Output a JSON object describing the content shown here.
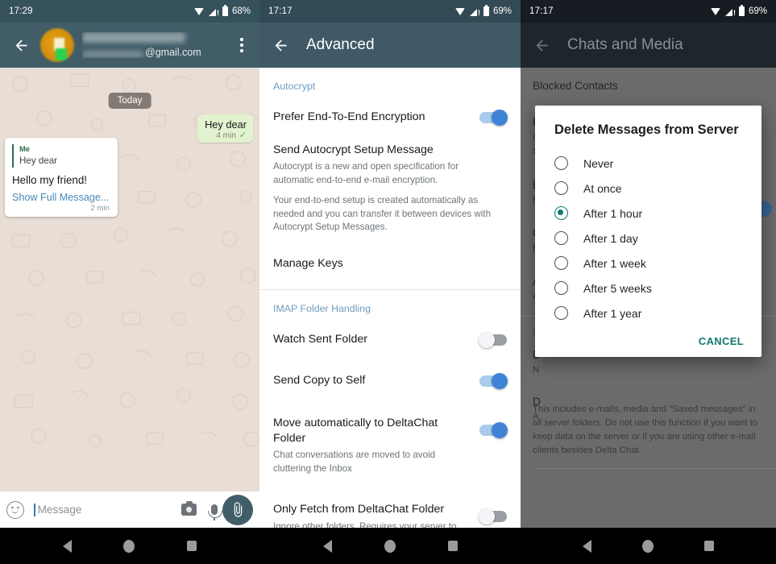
{
  "panel1": {
    "status": {
      "time": "17:29",
      "battery": "68%",
      "wifi_icon": "wifi-icon",
      "signal_icon": "signal-icon",
      "battery_icon": "battery-icon"
    },
    "appbar": {
      "back_icon": "back-arrow-icon",
      "avatar": "contact-avatar",
      "email_suffix": "@gmail.com",
      "overflow_icon": "overflow-menu-icon"
    },
    "chat": {
      "date_pill": "Today",
      "outgoing": {
        "text": "Hey dear",
        "time": "4 min",
        "status_icon": "sent-check-icon"
      },
      "notification": {
        "quote_author": "Me",
        "quote_text": "Hey dear",
        "body": "Hello my friend!",
        "link": "Show Full Message...",
        "time": "2 min"
      }
    },
    "compose": {
      "emoji_icon": "emoji-icon",
      "placeholder": "Message",
      "camera_icon": "camera-icon",
      "mic_icon": "microphone-icon",
      "attach_icon": "paperclip-icon"
    }
  },
  "panel2": {
    "status": {
      "time": "17:17",
      "battery": "69%"
    },
    "appbar": {
      "back_icon": "back-arrow-icon",
      "title": "Advanced"
    },
    "sections": [
      {
        "header": "Autocrypt",
        "rows": [
          {
            "title": "Prefer End-To-End Encryption",
            "subtitles": [],
            "toggle": "on"
          },
          {
            "title": "Send Autocrypt Setup Message",
            "subtitles": [
              "Autocrypt is a new and open specification for automatic end-to-end e-mail encryption.",
              "Your end-to-end setup is created automatically as needed and you can transfer it between devices with Autocrypt Setup Messages."
            ],
            "toggle": "none"
          },
          {
            "title": "Manage Keys",
            "subtitles": [],
            "toggle": "none"
          }
        ]
      },
      {
        "header": "IMAP Folder Handling",
        "rows": [
          {
            "title": "Watch Sent Folder",
            "subtitles": [],
            "toggle": "off"
          },
          {
            "title": "Send Copy to Self",
            "subtitles": [],
            "toggle": "on"
          },
          {
            "title": "Move automatically to DeltaChat Folder",
            "subtitles": [
              "Chat conversations are moved to avoid cluttering the Inbox"
            ],
            "toggle": "on"
          },
          {
            "title": "Only Fetch from DeltaChat Folder",
            "subtitles": [
              "Ignore other folders. Requires your server to move chat messages to the DeltaChat folder."
            ],
            "toggle": "off"
          }
        ]
      }
    ]
  },
  "panel3": {
    "status": {
      "time": "17:17",
      "battery": "69%"
    },
    "appbar": {
      "back_icon": "back-arrow-icon",
      "title": "Chats and Media"
    },
    "background_rows": [
      {
        "title": "Blocked Contacts",
        "subtitle": ""
      },
      {
        "title": "R",
        "subtitle": "If\nse"
      },
      {
        "title": "E",
        "subtitle": "P"
      },
      {
        "title": "O",
        "subtitle": "B"
      },
      {
        "title": "A",
        "subtitle": "A"
      },
      {
        "title": "D",
        "subtitle": ""
      },
      {
        "title": "D",
        "subtitle": "N"
      },
      {
        "title": "D",
        "subtitle": "A"
      }
    ],
    "footnote": "This includes e-mails, media and \"Saved messages\" in all server folders. Do not use this function if you want to keep data on the server or if you are using other e-mail clients besides Delta Chat.",
    "dialog": {
      "title": "Delete Messages from Server",
      "options": [
        {
          "label": "Never",
          "selected": false
        },
        {
          "label": "At once",
          "selected": false
        },
        {
          "label": "After 1 hour",
          "selected": true
        },
        {
          "label": "After 1 day",
          "selected": false
        },
        {
          "label": "After 1 week",
          "selected": false
        },
        {
          "label": "After 5 weeks",
          "selected": false
        },
        {
          "label": "After 1 year",
          "selected": false
        }
      ],
      "cancel_label": "CANCEL"
    }
  },
  "navbar": {
    "back_icon": "nav-back-icon",
    "home_icon": "nav-home-icon",
    "recents_icon": "nav-recents-icon"
  },
  "colors": {
    "appbar_teal": "#415d68",
    "appbar_black": "#1e262c",
    "statusbar_dark": "#35515c",
    "accent_blue": "#3f83d6",
    "section_header_blue": "#6e9bc0",
    "radio_selected_teal": "#107a6e",
    "bubble_green": "#e3f2cf",
    "chat_bg": "#e8ded5",
    "scrim_gray": "#6b6b6b"
  }
}
